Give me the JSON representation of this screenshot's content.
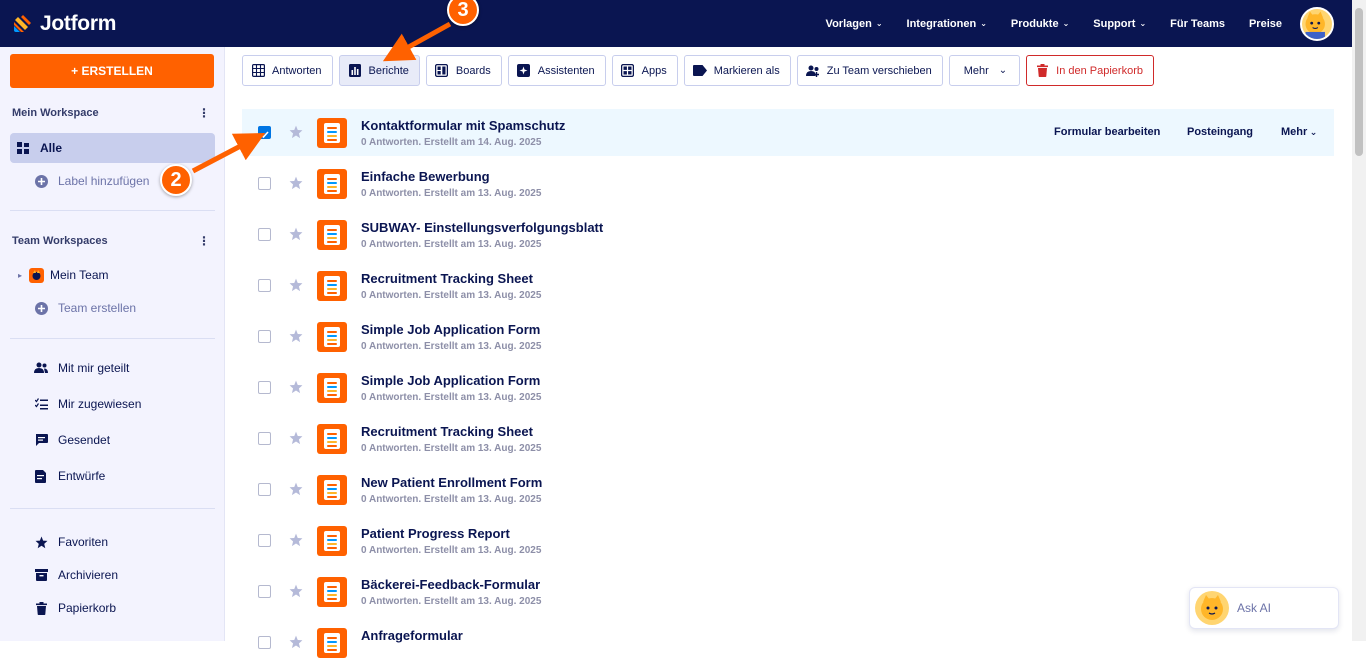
{
  "app": {
    "name": "Jotform"
  },
  "topnav": {
    "items": [
      {
        "label": "Vorlagen",
        "has_dropdown": true
      },
      {
        "label": "Integrationen",
        "has_dropdown": true
      },
      {
        "label": "Produkte",
        "has_dropdown": true
      },
      {
        "label": "Support",
        "has_dropdown": true
      },
      {
        "label": "Für Teams",
        "has_dropdown": false
      },
      {
        "label": "Preise",
        "has_dropdown": false
      }
    ]
  },
  "sidebar": {
    "create_label": "+ ERSTELLEN",
    "workspace_title": "Mein Workspace",
    "all_label": "Alle",
    "add_label": "Label hinzufügen",
    "team_title": "Team Workspaces",
    "my_team": "Mein Team",
    "create_team": "Team erstellen",
    "shared": "Mit mir geteilt",
    "assigned": "Mir zugewiesen",
    "sent": "Gesendet",
    "drafts": "Entwürfe",
    "favorites": "Favoriten",
    "archive": "Archivieren",
    "trash": "Papierkorb"
  },
  "toolbar": {
    "answers": "Antworten",
    "reports": "Berichte",
    "boards": "Boards",
    "assistants": "Assistenten",
    "apps": "Apps",
    "mark_as": "Markieren als",
    "move_team": "Zu Team verschieben",
    "more": "Mehr",
    "trash": "In den Papierkorb"
  },
  "row_actions": {
    "edit": "Formular bearbeiten",
    "inbox": "Posteingang",
    "more": "Mehr"
  },
  "forms": [
    {
      "title": "Kontaktformular mit Spamschutz",
      "subtitle": "0 Antworten. Erstellt am 14. Aug. 2025",
      "checked": true
    },
    {
      "title": "Einfache Bewerbung",
      "subtitle": "0 Antworten. Erstellt am 13. Aug. 2025",
      "checked": false
    },
    {
      "title": "SUBWAY- Einstellungsverfolgungsblatt",
      "subtitle": "0 Antworten. Erstellt am 13. Aug. 2025",
      "checked": false
    },
    {
      "title": "Recruitment Tracking Sheet",
      "subtitle": "0 Antworten. Erstellt am 13. Aug. 2025",
      "checked": false
    },
    {
      "title": "Simple Job Application Form",
      "subtitle": "0 Antworten. Erstellt am 13. Aug. 2025",
      "checked": false
    },
    {
      "title": "Simple Job Application Form",
      "subtitle": "0 Antworten. Erstellt am 13. Aug. 2025",
      "checked": false
    },
    {
      "title": "Recruitment Tracking Sheet",
      "subtitle": "0 Antworten. Erstellt am 13. Aug. 2025",
      "checked": false
    },
    {
      "title": "New Patient Enrollment Form",
      "subtitle": "0 Antworten. Erstellt am 13. Aug. 2025",
      "checked": false
    },
    {
      "title": "Patient Progress Report",
      "subtitle": "0 Antworten. Erstellt am 13. Aug. 2025",
      "checked": false
    },
    {
      "title": "Bäckerei-Feedback-Formular",
      "subtitle": "0 Antworten. Erstellt am 13. Aug. 2025",
      "checked": false
    },
    {
      "title": "Anfrageformular",
      "subtitle": "",
      "checked": false
    }
  ],
  "annotations": {
    "marker_2": "2",
    "marker_3": "3"
  },
  "ask_ai": {
    "label": "Ask AI"
  },
  "colors": {
    "navy": "#0a1551",
    "orange": "#ff6100",
    "danger": "#d02a2a",
    "checkbox": "#0075e3"
  }
}
